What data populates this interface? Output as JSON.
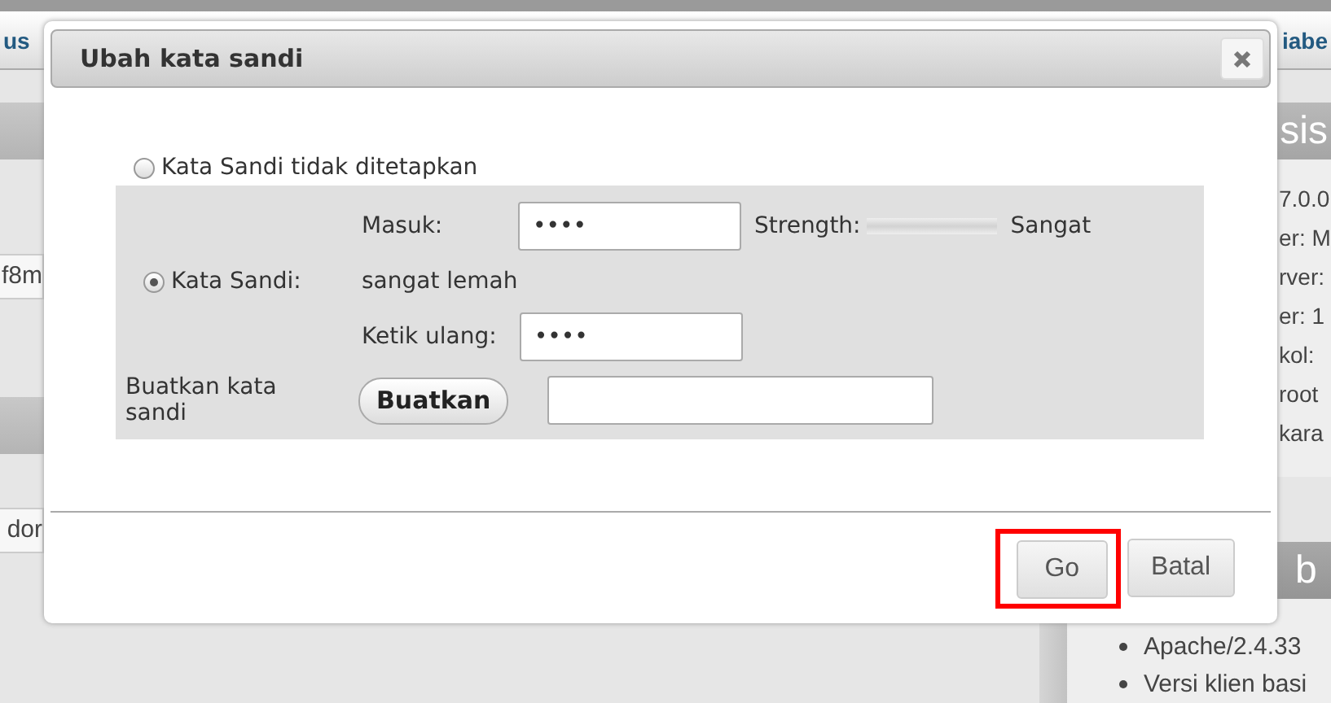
{
  "background": {
    "tabs": [
      {
        "label": "us"
      },
      {
        "label": "iabe"
      }
    ],
    "left_fragments": [
      "f8m",
      "dor"
    ],
    "server_panel": {
      "header": "sis",
      "lines": [
        "7.0.0",
        "er: M",
        "rver:",
        "er: 1",
        "kol:",
        "root",
        "kara"
      ]
    },
    "web_panel": {
      "header": "b",
      "bullets": [
        "Apache/2.4.33",
        "Versi klien basi"
      ]
    }
  },
  "dialog": {
    "title": "Ubah kata sandi",
    "options": [
      {
        "label": "Kata Sandi tidak ditetapkan",
        "selected": false
      },
      {
        "label": "Kata Sandi:",
        "selected": true
      }
    ],
    "enter_label": "Masuk:",
    "enter_value": "••••",
    "strength_label": "Strength:",
    "strength": {
      "level": 0
    },
    "strength_text": "Sangat",
    "strength_text_2": "sangat lemah",
    "retype_label": "Ketik ulang:",
    "retype_value": "••••",
    "generate_label": "Buatkan kata sandi",
    "generate_button": "Buatkan",
    "buttons": [
      {
        "label": "Go",
        "highlighted": true
      },
      {
        "label": "Batal",
        "highlighted": false
      }
    ]
  }
}
